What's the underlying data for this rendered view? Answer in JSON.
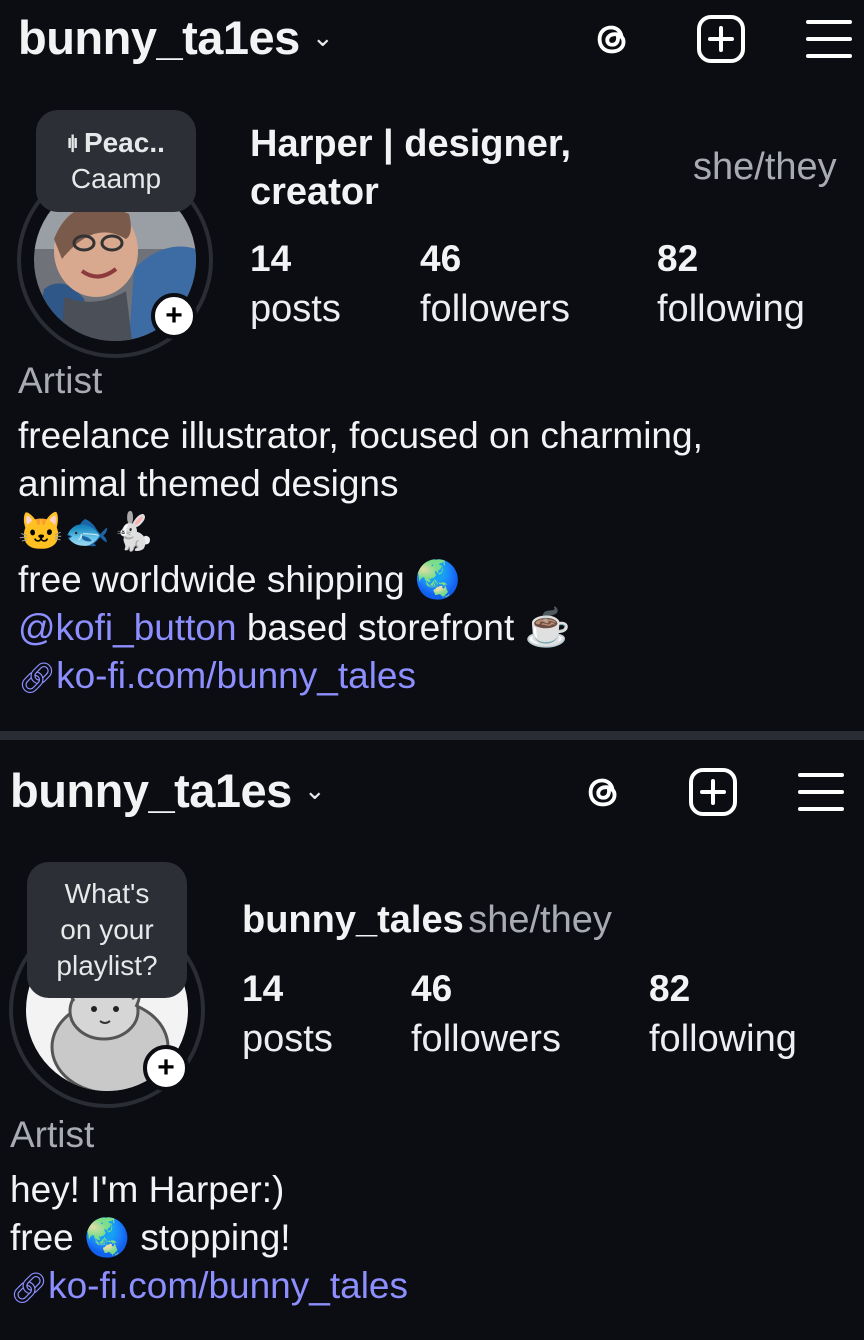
{
  "profile_top": {
    "username": "bunny_ta1es",
    "note": {
      "music_icon": "audio-bars-icon",
      "line1": "Peac..",
      "line2": "Caamp"
    },
    "display_name_line1": "Harper | designer,",
    "display_name_line2": "creator",
    "pronouns": "she/they",
    "stats": [
      {
        "value": "14",
        "label": "posts"
      },
      {
        "value": "46",
        "label": "followers"
      },
      {
        "value": "82",
        "label": "following"
      }
    ],
    "category": "Artist",
    "bio": {
      "line1": "freelance illustrator, focused on charming,",
      "line2": "animal themed designs",
      "line3": "🐱🐟🐇",
      "line4": "free worldwide shipping 🌏",
      "mention": "@kofi_button",
      "line5_rest": " based storefront ☕"
    },
    "link": "ko-fi.com/bunny_tales"
  },
  "profile_bottom": {
    "username": "bunny_ta1es",
    "note": {
      "line1": "What's",
      "line2": "on your",
      "line3": "playlist?"
    },
    "display_name": "bunny_tales",
    "pronouns": "she/they",
    "stats": [
      {
        "value": "14",
        "label": "posts"
      },
      {
        "value": "46",
        "label": "followers"
      },
      {
        "value": "82",
        "label": "following"
      }
    ],
    "category": "Artist",
    "bio": {
      "line1": "hey! I'm Harper:)",
      "line2": "free 🌏 stopping!"
    },
    "link": "ko-fi.com/bunny_tales"
  },
  "icons": {
    "dropdown": "chevron-down-icon",
    "threads": "threads-icon",
    "create": "plus-square-icon",
    "menu": "hamburger-menu-icon",
    "link": "link-icon",
    "add_story": "plus-icon"
  },
  "colors": {
    "background": "#0b0d12",
    "link": "#8d8fff",
    "muted": "#a8abb1",
    "note_bg": "#2c2f36"
  }
}
